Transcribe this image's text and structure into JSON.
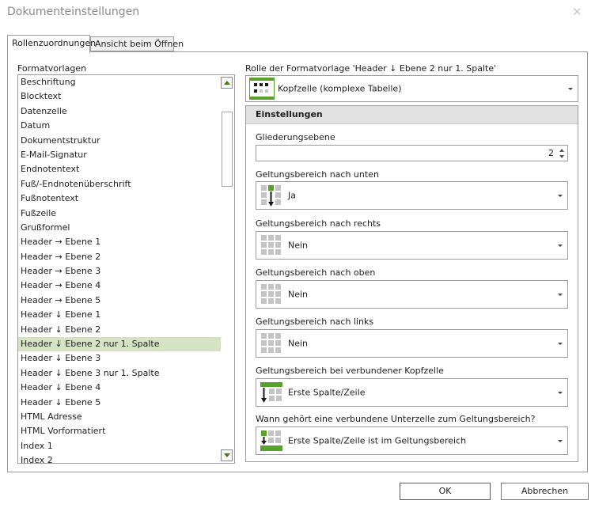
{
  "dialog": {
    "title": "Dokumenteinstellungen"
  },
  "tabs": [
    {
      "label": "Rollenzuordnungen"
    },
    {
      "label": "Ansicht beim Öffnen"
    }
  ],
  "formatvorlagen": {
    "label": "Formatvorlagen",
    "items": [
      "Beschriftung",
      "Blocktext",
      "Datenzelle",
      "Datum",
      "Dokumentstruktur",
      "E-Mail-Signatur",
      "Endnotentext",
      "Fuß/-Endnotenüberschrift",
      "Fußnotentext",
      "Fußzeile",
      "Grußformel",
      "Header → Ebene 1",
      "Header → Ebene 2",
      "Header → Ebene 3",
      "Header → Ebene 4",
      "Header → Ebene 5",
      "Header ↓ Ebene 1",
      "Header ↓ Ebene 2",
      "Header ↓ Ebene 2 nur 1. Spalte",
      "Header ↓ Ebene 3",
      "Header ↓ Ebene 3 nur 1. Spalte",
      "Header ↓ Ebene 4",
      "Header ↓ Ebene 5",
      "HTML Adresse",
      "HTML Vorformatiert",
      "Index 1",
      "Index 2"
    ],
    "selected": "Header ↓ Ebene 2 nur 1. Spalte"
  },
  "rolle": {
    "label": "Rolle der Formatvorlage 'Header ↓ Ebene 2 nur 1. Spalte'",
    "value": "Kopfzelle (komplexe Tabelle)"
  },
  "einstellungen": {
    "header": "Einstellungen",
    "gliederung": {
      "label": "Gliederungsebene",
      "value": "2"
    },
    "unten": {
      "label": "Geltungsbereich nach unten",
      "value": "Ja"
    },
    "rechts": {
      "label": "Geltungsbereich nach rechts",
      "value": "Nein"
    },
    "oben": {
      "label": "Geltungsbereich nach oben",
      "value": "Nein"
    },
    "links": {
      "label": "Geltungsbereich nach links",
      "value": "Nein"
    },
    "verbunden": {
      "label": "Geltungsbereich bei verbundener Kopfzelle",
      "value": "Erste Spalte/Zeile"
    },
    "unterzelle": {
      "label": "Wann gehört eine verbundene Unterzelle zum Geltungsbereich?",
      "value": "Erste Spalte/Zeile ist im Geltungsbereich"
    }
  },
  "buttons": {
    "ok": "OK",
    "cancel": "Abbrechen"
  },
  "colors": {
    "accent": "#5aa02c",
    "selection": "#d5e3c4",
    "grid": "#c4c4c4",
    "dark": "#1a1a1a"
  }
}
